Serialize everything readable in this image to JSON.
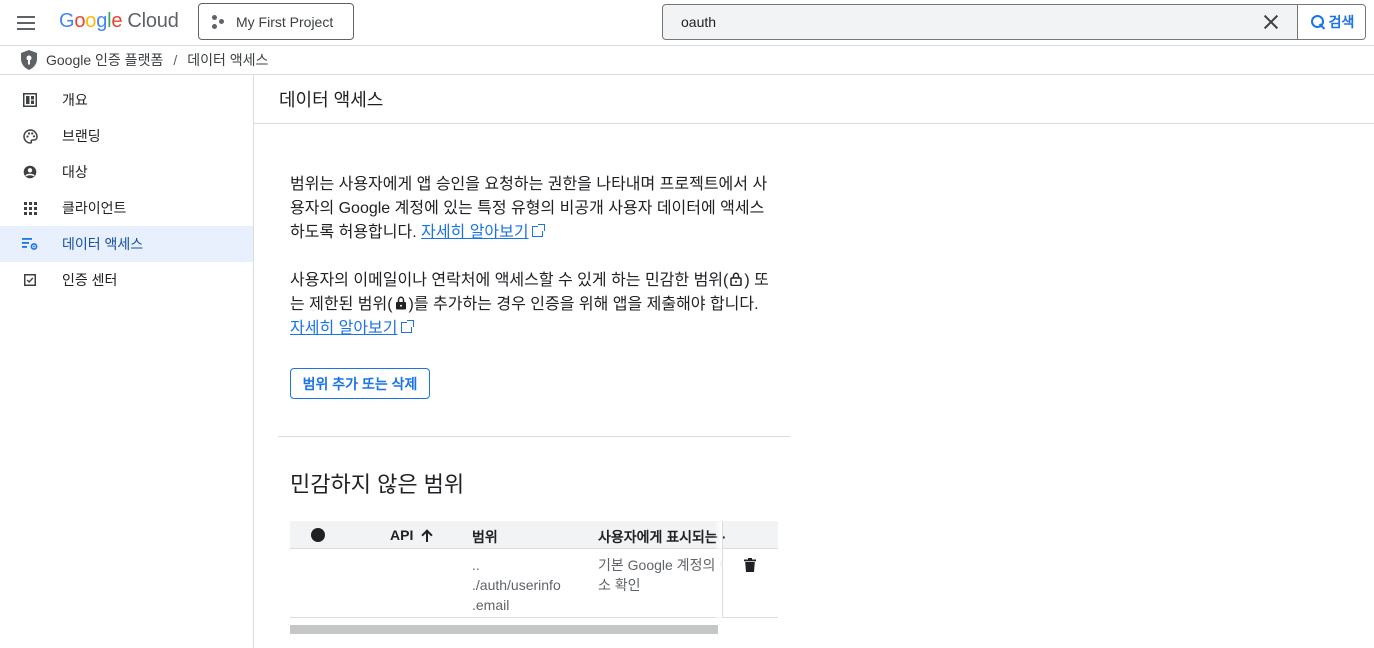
{
  "header": {
    "logo_letters": [
      "G",
      "o",
      "o",
      "g",
      "l",
      "e"
    ],
    "logo_product": "Cloud",
    "project_name": "My First Project",
    "search_value": "oauth",
    "search_button_label": "검색"
  },
  "breadcrumb": {
    "items": [
      "Google 인증 플랫폼",
      "데이터 액세스"
    ],
    "separator": "/"
  },
  "sidebar": {
    "items": [
      {
        "label": "개요",
        "icon": "dashboard-icon"
      },
      {
        "label": "브랜딩",
        "icon": "palette-icon"
      },
      {
        "label": "대상",
        "icon": "account-circle-icon"
      },
      {
        "label": "클라이언트",
        "icon": "apps-grid-icon"
      },
      {
        "label": "데이터 액세스",
        "icon": "data-access-icon",
        "active": true
      },
      {
        "label": "인증 센터",
        "icon": "verified-check-icon"
      }
    ]
  },
  "main": {
    "page_title": "데이터 액세스",
    "para1_text": "범위는 사용자에게 앱 승인을 요청하는 권한을 나타내며 프로젝트에서 사용자의 Google 계정에 있는 특정 유형의 비공개 사용자 데이터에 액세스하도록 허용합니다. ",
    "para1_link": "자세히 알아보기",
    "para2_text_a": "사용자의 이메일이나 연락처에 액세스할 수 있게 하는 민감한 범위(",
    "para2_text_b": ") 또는 제한된 범위(",
    "para2_text_c": ")를 추가하는 경우 인증을 위해 앱을 제출해야 합니다. ",
    "para2_link": "자세히 알아보기",
    "scope_button_label": "범위 추가 또는 삭제",
    "section_title": "민감하지 않은 범위",
    "table": {
      "columns": [
        "API",
        "범위",
        "사용자에게 표시되는 ·"
      ],
      "rows": [
        {
          "api": "",
          "scope_lines": [
            "..",
            "./auth/userinfo",
            ".email"
          ],
          "description_lines": [
            "기본 Google 계정의 이",
            "소 확인"
          ]
        }
      ]
    }
  },
  "colors": {
    "accent": "#1a73e8",
    "active_bg": "#e8f0fe",
    "border": "#dadce0",
    "table_header_bg": "#f1f3f4"
  }
}
